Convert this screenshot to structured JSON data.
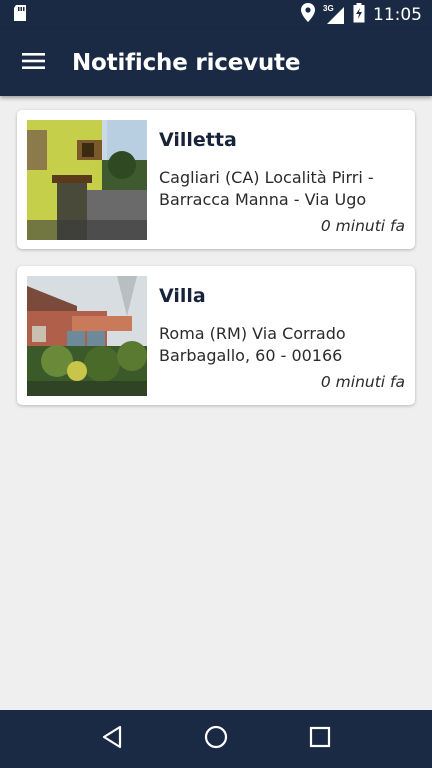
{
  "status_bar": {
    "network": "3G",
    "time": "11:05",
    "icons": [
      "sd-card-icon",
      "location-icon",
      "signal-icon",
      "battery-charging-icon"
    ]
  },
  "app_bar": {
    "title": "Notifiche ricevute",
    "menu_icon": "hamburger-menu-icon"
  },
  "notifications": [
    {
      "title": "Villetta",
      "address": "Cagliari (CA) Località Pirri - Barracca Manna - Via Ugo",
      "time": "0 minuti fa",
      "image": "house-photo-villetta"
    },
    {
      "title": "Villa",
      "address": "Roma (RM) Via Corrado Barbagallo, 60 - 00166",
      "time": "0 minuti fa",
      "image": "house-photo-villa"
    }
  ],
  "nav_bar": {
    "buttons": [
      "back-icon",
      "home-icon",
      "recents-icon"
    ]
  },
  "colors": {
    "primary": "#1b2a44",
    "background": "#efefef",
    "card": "#ffffff",
    "title_text": "#17233a"
  }
}
